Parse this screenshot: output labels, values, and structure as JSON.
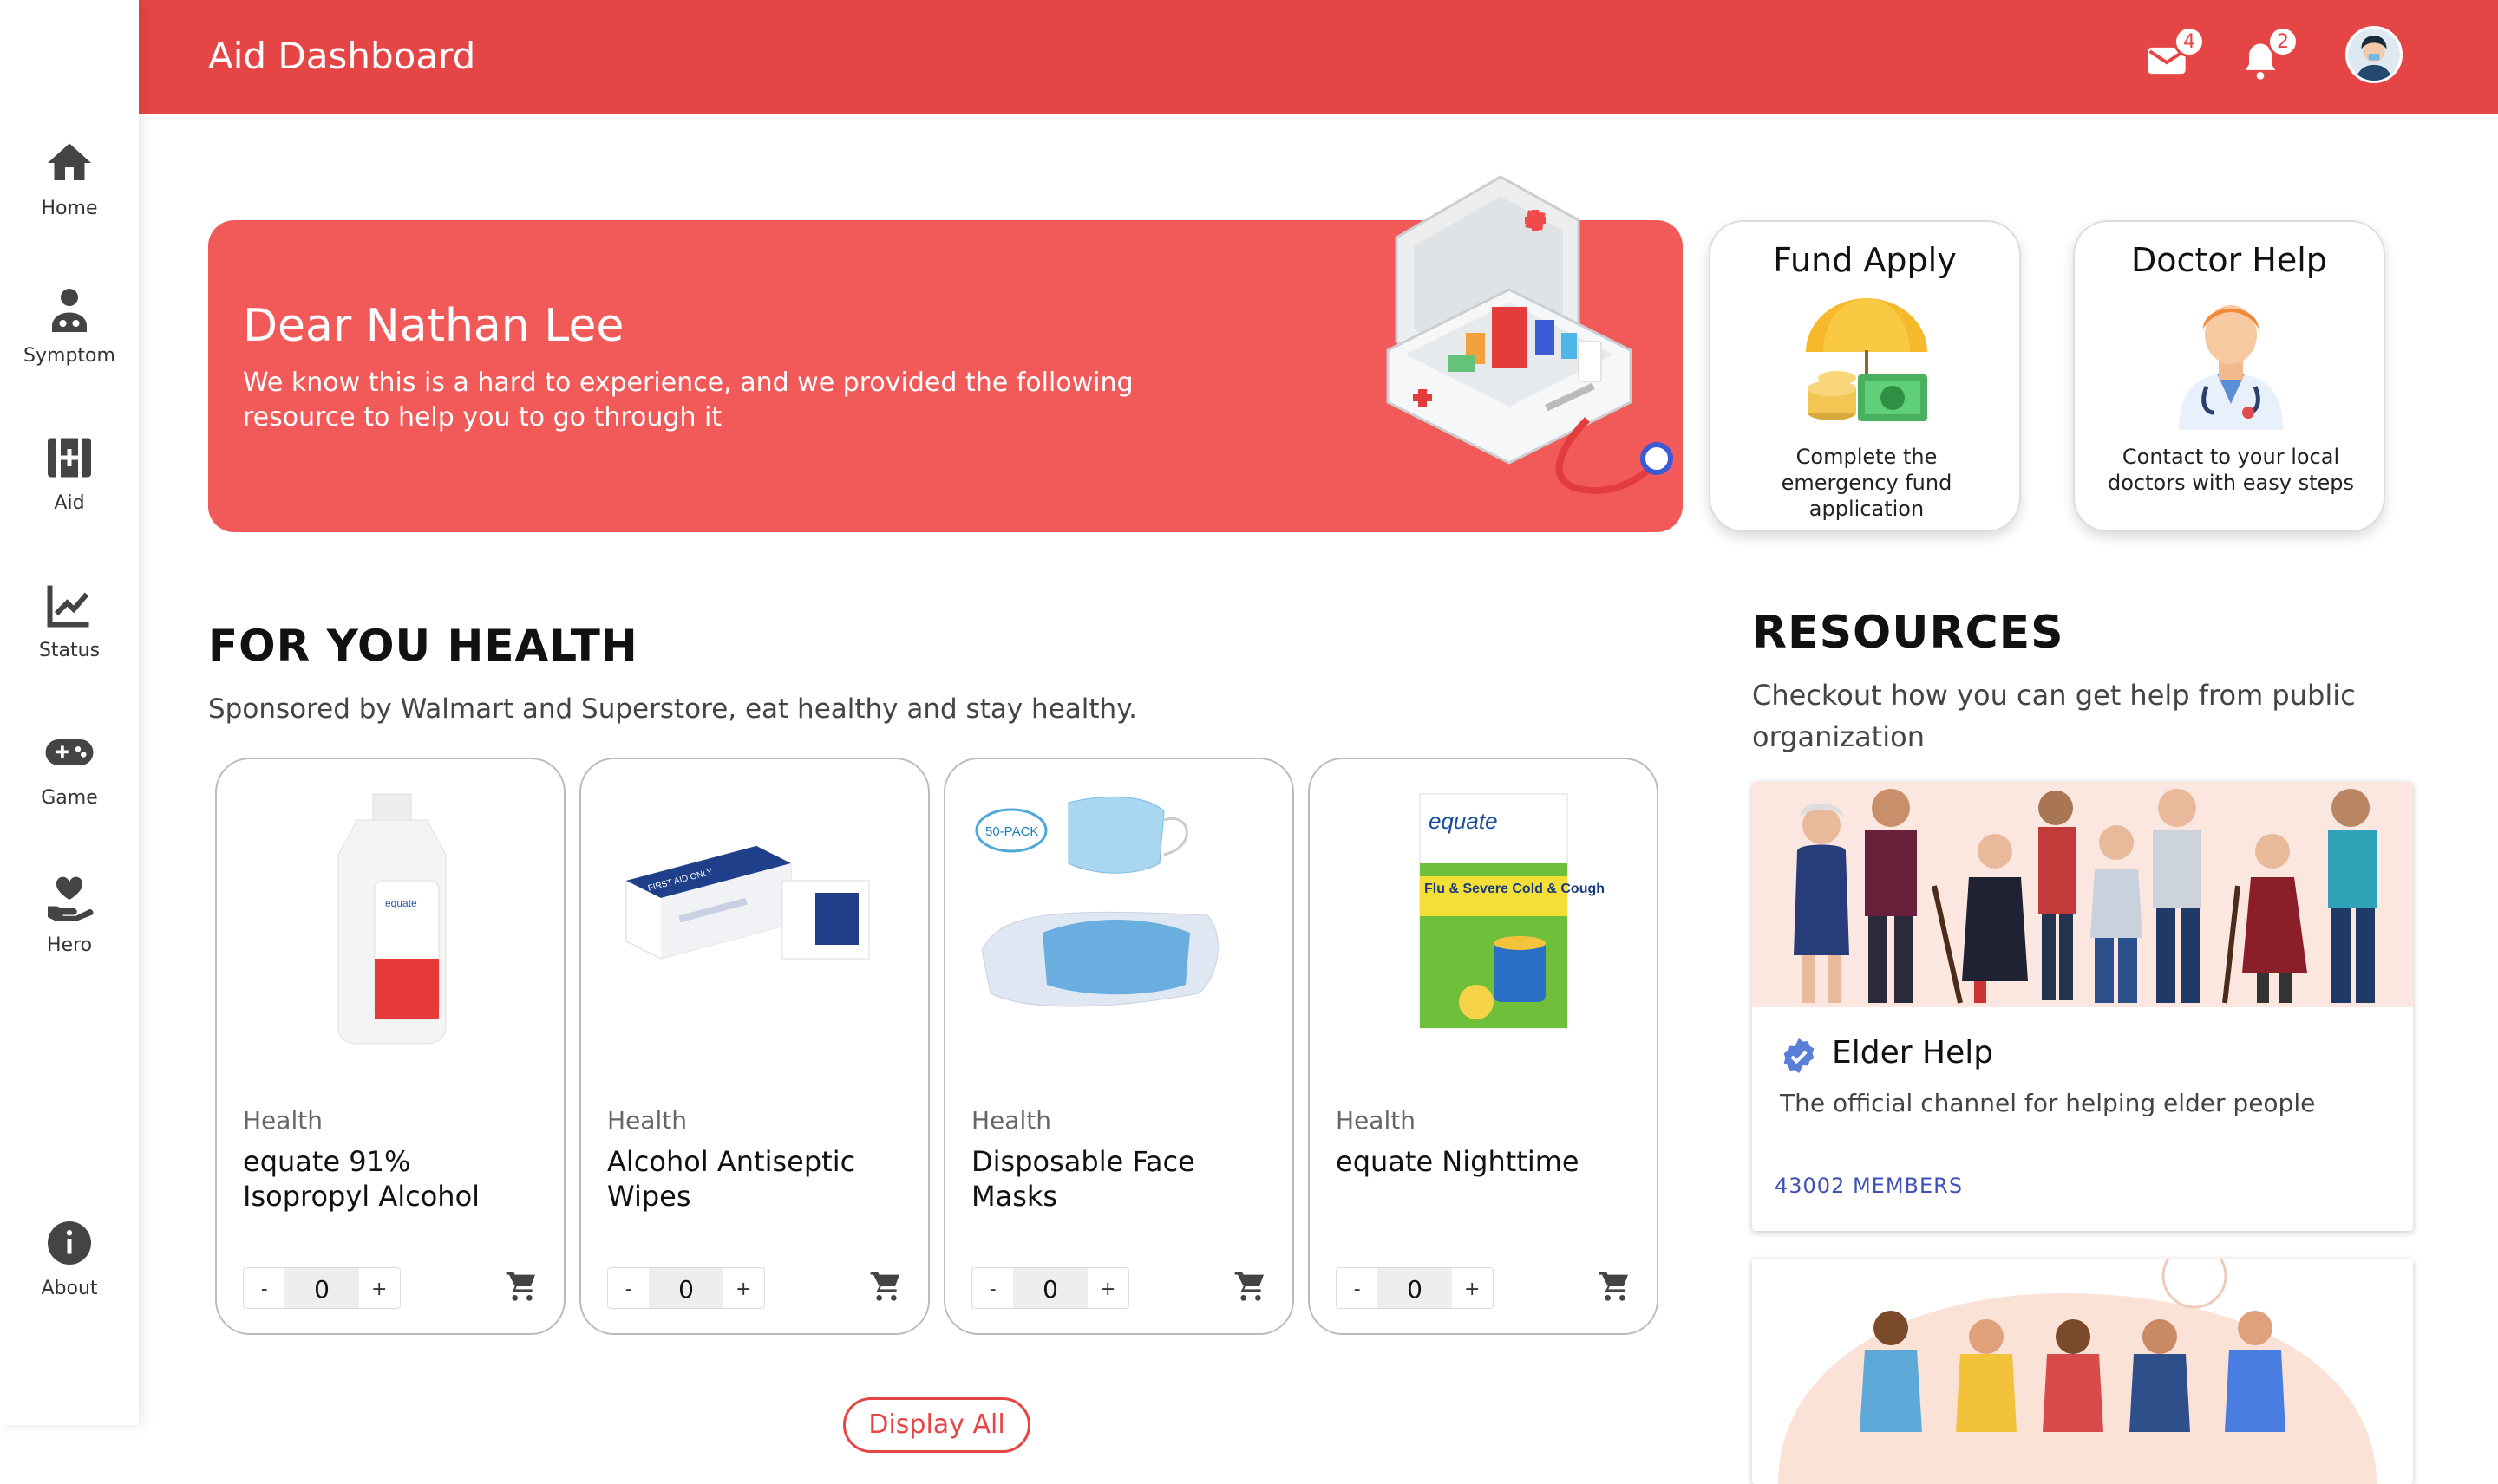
{
  "header": {
    "title": "Aid Dashboard",
    "mail_count": "4",
    "notification_count": "2"
  },
  "sidebar": {
    "items": [
      {
        "label": "Home",
        "icon": "home-icon"
      },
      {
        "label": "Symptom",
        "icon": "doctor-icon"
      },
      {
        "label": "Aid",
        "icon": "medical-kit-icon"
      },
      {
        "label": "Status",
        "icon": "chart-line-icon"
      },
      {
        "label": "Game",
        "icon": "gamepad-icon"
      },
      {
        "label": "Hero",
        "icon": "hand-heart-icon"
      }
    ],
    "about": {
      "label": "About",
      "icon": "info-icon"
    }
  },
  "banner": {
    "title": "Dear Nathan Lee",
    "text": "We know this is a hard to experience, and we provided the following resource to help you to go through it"
  },
  "quick_cards": [
    {
      "title": "Fund Apply",
      "desc": "Complete the emergency fund application"
    },
    {
      "title": "Doctor Help",
      "desc": "Contact to your local doctors with easy steps"
    }
  ],
  "health": {
    "title": "FOR YOU HEALTH",
    "subtitle": "Sponsored by Walmart and Superstore, eat healthy and stay healthy.",
    "products": [
      {
        "category": "Health",
        "name": "equate 91% Isopropyl Alcohol",
        "qty": "0"
      },
      {
        "category": "Health",
        "name": "Alcohol Antiseptic Wipes",
        "qty": "0"
      },
      {
        "category": "Health",
        "name": "Disposable Face Masks",
        "qty": "0"
      },
      {
        "category": "Health",
        "name": "equate Nighttime",
        "qty": "0"
      }
    ],
    "stepper_minus": "-",
    "stepper_plus": "+",
    "display_all": "Display All",
    "product_labels": {
      "equate": "equate",
      "pack": "50-PACK",
      "flu": "Flu & Severe Cold & Cough",
      "first_aid": "FIRST AID ONLY"
    }
  },
  "resources": {
    "title": "RESOURCES",
    "subtitle": "Checkout how you can get help from public organization",
    "cards": [
      {
        "title": "Elder Help",
        "desc": "The official channel for helping elder people",
        "members": "43002 MEMBERS"
      }
    ]
  },
  "colors": {
    "accent": "#e64545",
    "banner": "#f25a5a",
    "link": "#3f51b5"
  }
}
